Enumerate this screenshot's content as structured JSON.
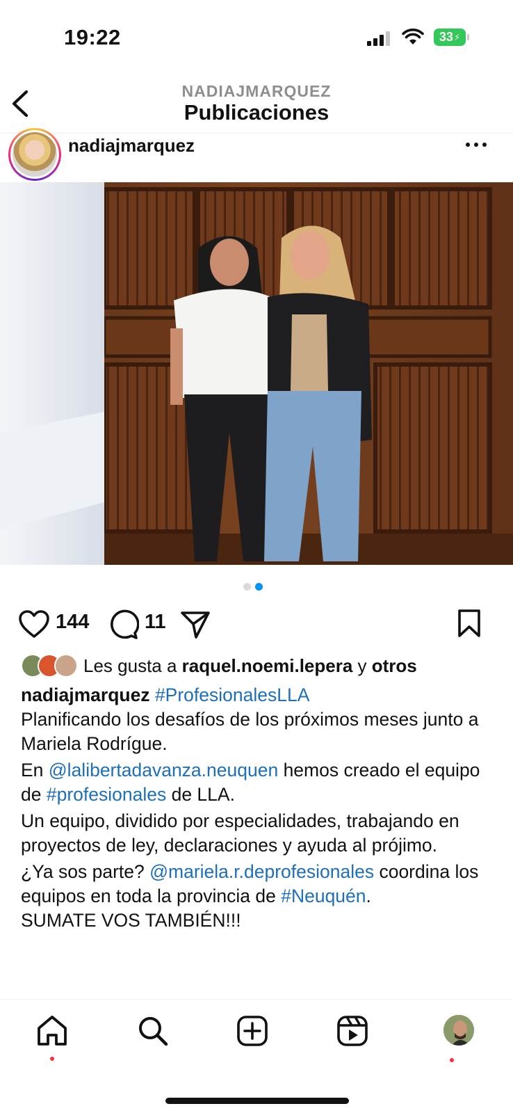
{
  "status": {
    "time": "19:22",
    "battery": "33"
  },
  "header": {
    "account": "NADIAJMARQUEZ",
    "title": "Publicaciones"
  },
  "post": {
    "username": "nadiajmarquez",
    "likes_count": "144",
    "comments_count": "11",
    "carousel_pages": 2,
    "carousel_active": 2
  },
  "likes_line": {
    "prefix": "Les gusta a ",
    "user": "raquel.noemi.lepera",
    "middle": " y ",
    "others": "otros"
  },
  "caption": {
    "username": "nadiajmarquez",
    "hashtag1": "#ProfesionalesLLA",
    "line1": "Planificando los desafíos de los próximos meses junto a Mariela Rodrígue.",
    "p2_start": "En ",
    "p2_mention": "@lalibertadavanza.neuquen",
    "p2_mid": " hemos creado el equipo de ",
    "p2_hashtag": "#profesionales",
    "p2_end": " de LLA.",
    "p3": "Un equipo, dividido por especialidades, trabajando en proyectos de ley, declaraciones y ayuda al prójimo.",
    "p4_start": "¿Ya sos parte? ",
    "p4_mention": "@mariela.r.deprofesionales",
    "p4_mid": " coordina los equipos en toda la provincia de ",
    "p4_hashtag": "#Neuquén",
    "p4_end": ".",
    "p5": "SUMATE VOS TAMBIÉN!!!"
  },
  "colors": {
    "link": "#1d6fb8",
    "battery": "#34c759",
    "carousel_active": "#0095f6",
    "notification": "#ff3040"
  },
  "icons": [
    "back-icon",
    "more-icon",
    "heart-icon",
    "comment-icon",
    "share-icon",
    "bookmark-icon",
    "home-icon",
    "search-icon",
    "create-icon",
    "reels-icon"
  ]
}
